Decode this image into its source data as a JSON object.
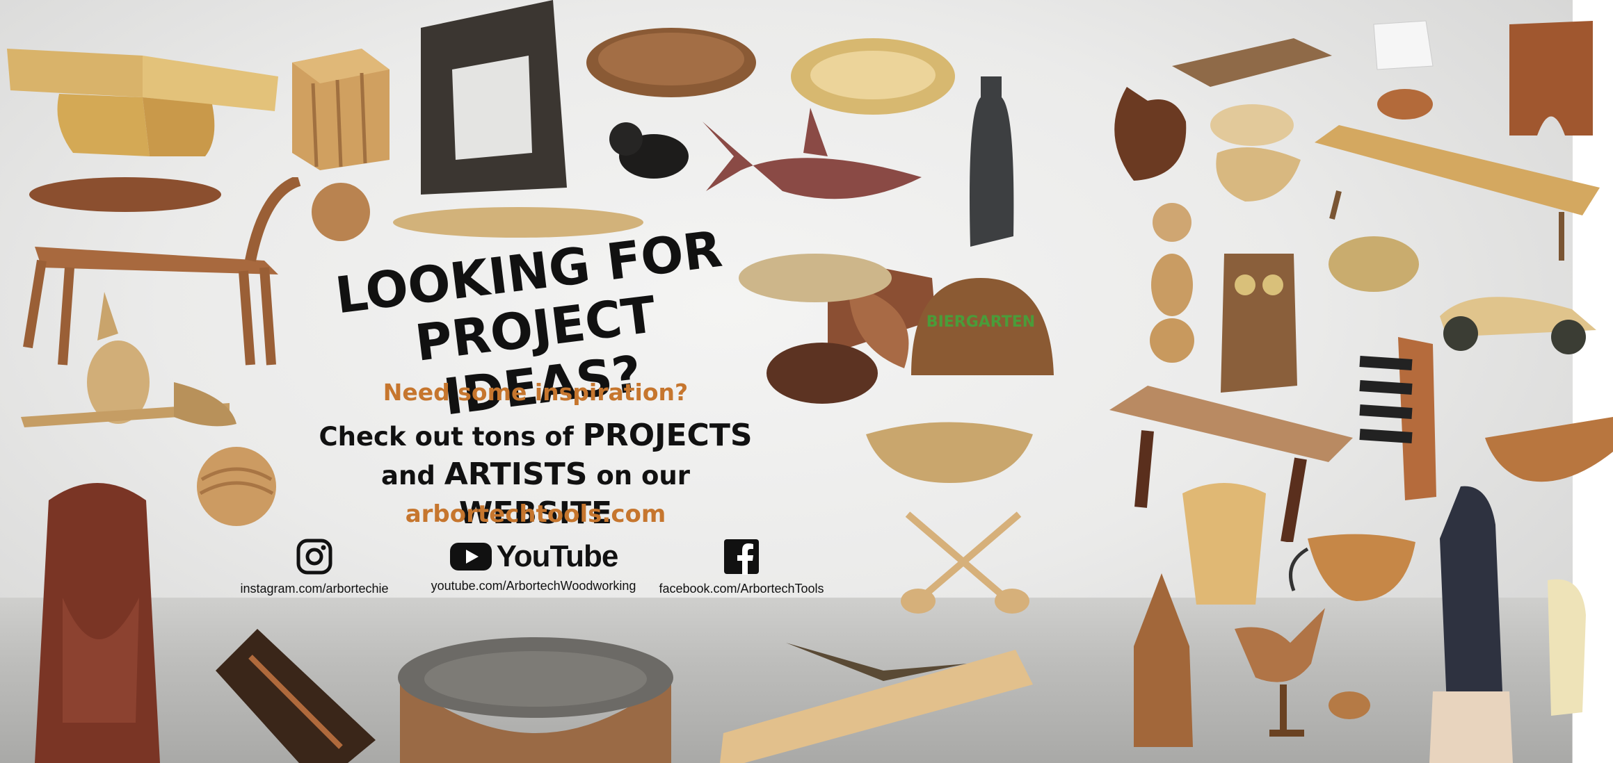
{
  "headline": {
    "line1": "LOOKING FOR",
    "line2": "PROJECT IDEAS?"
  },
  "subhead": "Need some inspiration?",
  "body": {
    "part1": "Check out tons of ",
    "projects": "PROJECTS",
    "part2": "and ",
    "artists": "ARTISTS",
    "part3": " on our ",
    "website": "WEBSITE"
  },
  "website_url": "arbortechtools.com",
  "social": {
    "instagram": {
      "icon": "instagram-icon",
      "label": "instagram.com/arbortechie"
    },
    "youtube": {
      "icon": "youtube-icon",
      "wordmark": "YouTube",
      "label": "youtube.com/ArbortechWoodworking"
    },
    "facebook": {
      "icon": "facebook-icon",
      "label": "facebook.com/ArbortechTools"
    }
  },
  "colors": {
    "accent": "#c6762e",
    "text": "#111111",
    "background": "#ebebea"
  },
  "sign_text": "BIERGARTEN"
}
